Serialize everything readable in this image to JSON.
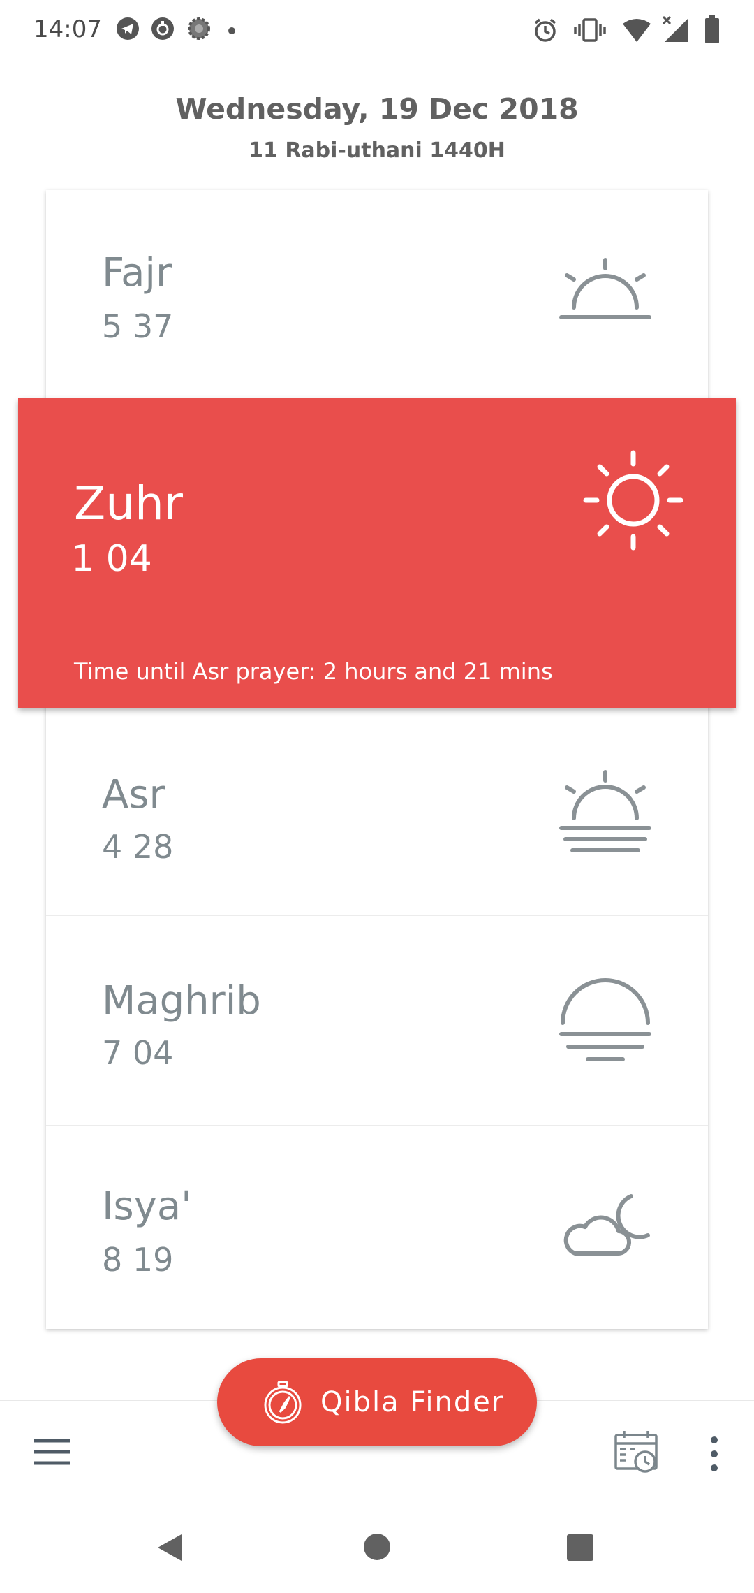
{
  "status_bar": {
    "time": "14:07",
    "left_icons": [
      "telegram-icon",
      "notification-icon",
      "settings-gear-icon",
      "dot-icon"
    ],
    "right_icons": [
      "alarm-icon",
      "vibrate-icon",
      "wifi-icon",
      "signal-icon",
      "battery-icon"
    ]
  },
  "header": {
    "date": "Wednesday, 19 Dec 2018",
    "hijri_date": "11 Rabi-uthani 1440H"
  },
  "prayers": [
    {
      "name": "Fajr",
      "time": "5 37",
      "icon": "sunrise-icon"
    },
    {
      "name": "Zuhr",
      "time": "1 04",
      "icon": "sun-icon",
      "active": true
    },
    {
      "name": "Asr",
      "time": "4 28",
      "icon": "sun-horizon-icon"
    },
    {
      "name": "Maghrib",
      "time": "7 04",
      "icon": "sunset-icon"
    },
    {
      "name": "Isya'",
      "time": "8 19",
      "icon": "moon-cloud-icon"
    }
  ],
  "active_countdown": "Time until Asr prayer: 2 hours and 21 mins",
  "fab": {
    "label": "Qibla Finder",
    "icon": "compass-icon"
  },
  "bottom_bar": {
    "menu_icon": "hamburger-menu-icon",
    "schedule_icon": "calendar-clock-icon",
    "more_icon": "more-vertical-icon"
  },
  "colors": {
    "accent": "#e94e4c",
    "fab": "#e84a3f",
    "text_grey": "#808a8f",
    "header_grey": "#616161"
  }
}
